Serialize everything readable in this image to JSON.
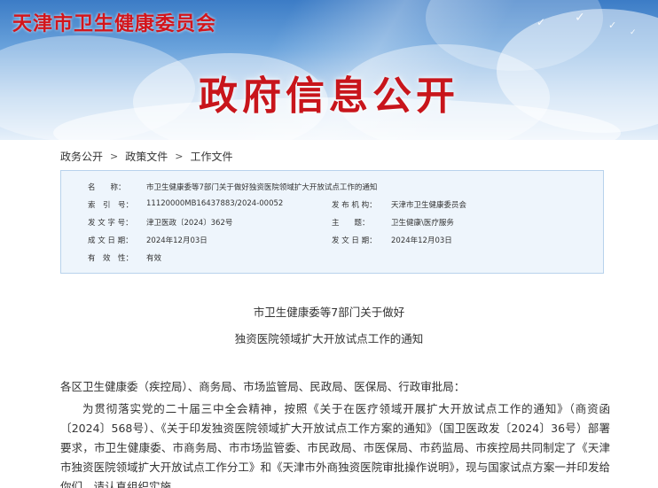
{
  "header": {
    "org_name": "天津市卫生健康委员会",
    "banner_title": "政府信息公开"
  },
  "breadcrumb": {
    "items": [
      "政务公开",
      "政策文件",
      "工作文件"
    ],
    "separator": ">"
  },
  "info": {
    "name_label": "名　　称：",
    "name_value": "市卫生健康委等7部门关于做好独资医院领域扩大开放试点工作的通知",
    "index_label": "索　引　号：",
    "index_value": "11120000MB16437883/2024-00052",
    "issuer_label": "发 布 机 构：",
    "issuer_value": "天津市卫生健康委员会",
    "docno_label": "发 文 字 号：",
    "docno_value": "津卫医政〔2024〕362号",
    "subject_label": "主　　题：",
    "subject_value": "卫生健康\\医疗服务",
    "date_label": "成 文 日 期：",
    "date_value": "2024年12月03日",
    "pubdate_label": "发 文 日 期：",
    "pubdate_value": "2024年12月03日",
    "validity_label": "有　效　性：",
    "validity_value": "有效"
  },
  "document": {
    "title_line1": "市卫生健康委等7部门关于做好",
    "title_line2": "独资医院领域扩大开放试点工作的通知",
    "salutation": "各区卫生健康委（疾控局）、商务局、市场监管局、民政局、医保局、行政审批局：",
    "paragraph1": "为贯彻落实党的二十届三中全会精神，按照《关于在医疗领域开展扩大开放试点工作的通知》（商资函〔2024〕568号）、《关于印发独资医院领域扩大开放试点工作方案的通知》（国卫医政发〔2024〕36号）部署要求，市卫生健康委、市商务局、市市场监管委、市民政局、市医保局、市药监局、市疾控局共同制定了《天津市独资医院领域扩大开放试点工作分工》和《天津市外商独资医院审批操作说明》，现与国家试点方案一并印发给你们，请认真组织实施。"
  },
  "colors": {
    "brand_red": "#d3151b",
    "info_bg": "#eef5fc",
    "info_border": "#b8d2ec"
  }
}
